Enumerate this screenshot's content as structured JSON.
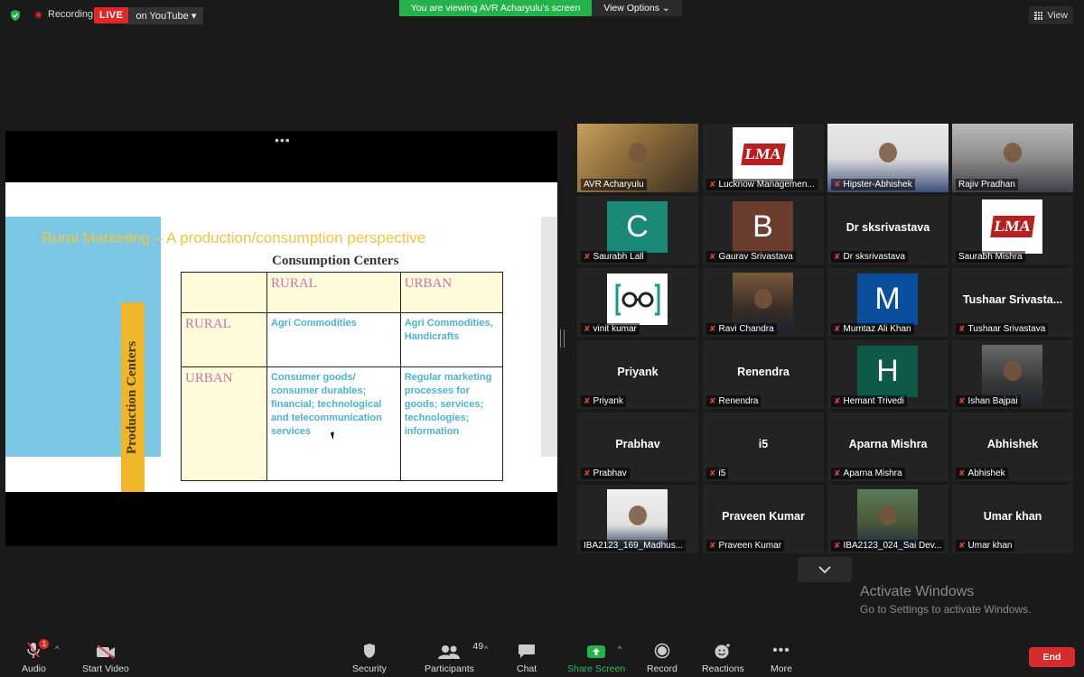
{
  "topbar": {
    "recording": "Recording",
    "live_badge": "LIVE",
    "live_target": "on YouTube",
    "viewing": "You are viewing AVR Acharyulu's screen",
    "view_options": "View Options",
    "view": "View"
  },
  "slide": {
    "title": "Rural Marketing – A production/consumption perspective",
    "consumption_title": "Consumption Centers",
    "production_label": "Production Centers",
    "col_rural": "RURAL",
    "col_urban": "URBAN",
    "row_rural": "RURAL",
    "row_urban": "URBAN",
    "rr": "Agri Commodities",
    "ru": "Agri Commodities, Handicrafts",
    "ur": "Consumer goods/ consumer durables; financial; technological and telecommunication services",
    "uu": "Regular marketing processes for goods; services; technologies; information"
  },
  "participants": [
    {
      "name": "AVR Acharyulu",
      "kind": "photo",
      "muted": false,
      "active": true
    },
    {
      "name": "Lucknow Managemen...",
      "kind": "logo",
      "logo": "LMA",
      "muted": true
    },
    {
      "name": "Hipster-Abhishek",
      "kind": "photo",
      "muted": true
    },
    {
      "name": "Rajiv Pradhan",
      "kind": "photo",
      "muted": false
    },
    {
      "name": "Saurabh Lall",
      "kind": "avatar",
      "letter": "C",
      "color": "#1a8a76",
      "muted": true
    },
    {
      "name": "Gaurav Srivastava",
      "kind": "avatar",
      "letter": "B",
      "color": "#6b3d2e",
      "muted": true
    },
    {
      "name": "Dr sksrivastava",
      "kind": "text",
      "big": "Dr sksrivastava",
      "muted": true
    },
    {
      "name": "Saurabh Mishra",
      "kind": "logo",
      "logo": "LMA",
      "muted": false
    },
    {
      "name": "vinit kumar",
      "kind": "glasses",
      "muted": true
    },
    {
      "name": "Ravi Chandra",
      "kind": "photo",
      "muted": true
    },
    {
      "name": "Mumtaz Ali Khan",
      "kind": "avatar",
      "letter": "M",
      "color": "#0a4f9e",
      "muted": true
    },
    {
      "name": "Tushaar Srivastava",
      "kind": "text",
      "big": "Tushaar  Srivasta...",
      "muted": true
    },
    {
      "name": "Priyank",
      "kind": "text",
      "big": "Priyank",
      "muted": true
    },
    {
      "name": "Renendra",
      "kind": "text",
      "big": "Renendra",
      "muted": true
    },
    {
      "name": "Hemant Trivedi",
      "kind": "avatar",
      "letter": "H",
      "color": "#0e5a49",
      "muted": true
    },
    {
      "name": "Ishan Bajpai",
      "kind": "photo",
      "muted": true
    },
    {
      "name": "Prabhav",
      "kind": "text",
      "big": "Prabhav",
      "muted": true
    },
    {
      "name": "i5",
      "kind": "text",
      "big": "i5",
      "muted": true
    },
    {
      "name": "Aparna Mishra",
      "kind": "text",
      "big": "Aparna Mishra",
      "muted": true
    },
    {
      "name": "Abhishek",
      "kind": "text",
      "big": "Abhishek",
      "muted": true
    },
    {
      "name": "IBA2123_169_Madhus...",
      "kind": "photo",
      "muted": false
    },
    {
      "name": "Praveen Kumar",
      "kind": "text",
      "big": "Praveen Kumar",
      "muted": true
    },
    {
      "name": "IBA2123_024_Sai Dev...",
      "kind": "photo",
      "muted": true
    },
    {
      "name": "Umar khan",
      "kind": "text",
      "big": "Umar khan",
      "muted": true
    }
  ],
  "watermark": {
    "line1": "Activate Windows",
    "line2": "Go to Settings to activate Windows."
  },
  "toolbar": {
    "audio": "Audio",
    "audio_badge": "1",
    "start_video": "Start Video",
    "security": "Security",
    "participants": "Participants",
    "participants_count": "49",
    "chat": "Chat",
    "share_screen": "Share Screen",
    "record": "Record",
    "reactions": "Reactions",
    "more": "More",
    "end": "End"
  }
}
